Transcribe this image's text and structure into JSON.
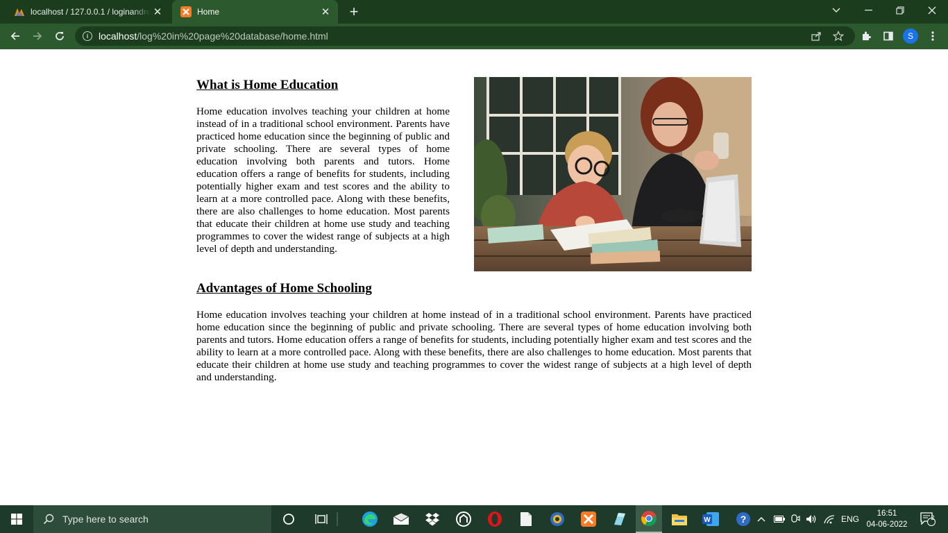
{
  "browser": {
    "tabs": [
      {
        "title": "localhost / 127.0.0.1 / loginandre",
        "active": false
      },
      {
        "title": "Home",
        "active": true
      }
    ],
    "address": {
      "host": "localhost",
      "path": "/log%20in%20page%20database/home.html"
    },
    "profile_initial": "S"
  },
  "page": {
    "heading1": "What is Home Education",
    "paragraph1": "Home education involves teaching your children at home instead of in a traditional school environment. Parents have practiced home education since the beginning of public and private schooling. There are several types of home education involving both parents and tutors. Home education offers a range of benefits for students, including potentially higher exam and test scores and the ability to learn at a more controlled pace. Along with these benefits, there are also challenges to home education. Most parents that educate their children at home use study and teaching programmes to cover the widest range of subjects at a high level of depth and understanding.",
    "heading2": "Advantages of Home Schooling",
    "paragraph2": "Home education involves teaching your children at home instead of in a traditional school environment. Parents have practiced home education since the beginning of public and private schooling. There are several types of home education involving both parents and tutors. Home education offers a range of benefits for students, including potentially higher exam and test scores and the ability to learn at a more controlled pace. Along with these benefits, there are also challenges to home education. Most parents that educate their children at home use study and teaching programmes to cover the widest range of subjects at a high level of depth and understanding."
  },
  "taskbar": {
    "search_placeholder": "Type here to search",
    "language": "ENG",
    "time": "16:51",
    "date": "04-06-2022",
    "notification_count": "2"
  },
  "colors": {
    "tabbar": "#1b3d1e",
    "toolbar": "#2c5a2e",
    "taskbar": "#1e3a2a"
  }
}
